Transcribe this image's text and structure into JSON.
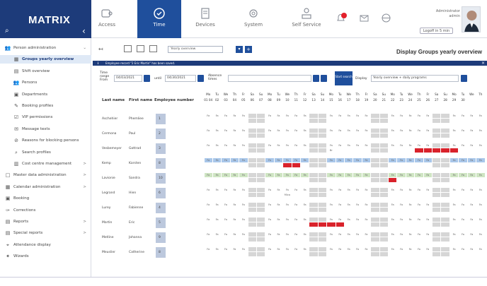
{
  "brand": {
    "name": "MATRIX",
    "search_icon": "search-icon",
    "collapse_icon": "chevron-left-icon"
  },
  "nav": [
    {
      "label": "Access",
      "icon": "door-access-icon",
      "active": false
    },
    {
      "label": "Time",
      "icon": "clock-icon",
      "active": true
    },
    {
      "label": "Devices",
      "icon": "terminal-device-icon",
      "active": false
    },
    {
      "label": "System",
      "icon": "gear-icon",
      "active": false
    },
    {
      "label": "Self Service",
      "icon": "person-desk-icon",
      "active": false
    }
  ],
  "header_icons": {
    "notification": "bell-icon",
    "mail": "mail-icon",
    "globe": "globe-icon"
  },
  "user": {
    "role": "Administrator",
    "name": "admin",
    "logoff": "Logoff in 5 min"
  },
  "sidebar": {
    "items": [
      {
        "label": "Person administration",
        "icon": "users-icon",
        "arrow": "⌄",
        "level": 0,
        "selected": false
      },
      {
        "label": "Groups yearly overview",
        "icon": "calendar-grid-icon",
        "arrow": "",
        "level": 1,
        "selected": true
      },
      {
        "label": "Shift overview",
        "icon": "chart-icon",
        "arrow": "",
        "level": 1,
        "selected": false
      },
      {
        "label": "Persons",
        "icon": "users-icon",
        "arrow": "",
        "level": 1,
        "selected": false
      },
      {
        "label": "Departments",
        "icon": "building-icon",
        "arrow": "",
        "level": 1,
        "selected": false
      },
      {
        "label": "Booking profiles",
        "icon": "pencil-icon",
        "arrow": "",
        "level": 1,
        "selected": false
      },
      {
        "label": "VIP permissions",
        "icon": "badge-icon",
        "arrow": "",
        "level": 1,
        "selected": false
      },
      {
        "label": "Message texts",
        "icon": "message-icon",
        "arrow": "",
        "level": 1,
        "selected": false
      },
      {
        "label": "Reasons for blocking persons",
        "icon": "block-person-icon",
        "arrow": "",
        "level": 1,
        "selected": false
      },
      {
        "label": "Search profiles",
        "icon": "search-icon",
        "arrow": "",
        "level": 1,
        "selected": false
      },
      {
        "label": "Cost centre management",
        "icon": "cost-centre-icon",
        "arrow": ">",
        "level": 1,
        "selected": false
      },
      {
        "label": "Master data administration",
        "icon": "document-icon",
        "arrow": ">",
        "level": 0,
        "selected": false
      },
      {
        "label": "Calendar administration",
        "icon": "calendar-icon",
        "arrow": ">",
        "level": 0,
        "selected": false
      },
      {
        "label": "Booking",
        "icon": "booking-icon",
        "arrow": "",
        "level": 0,
        "selected": false
      },
      {
        "label": "Corrections",
        "icon": "wrench-icon",
        "arrow": "",
        "level": 0,
        "selected": false
      },
      {
        "label": "Reports",
        "icon": "report-icon",
        "arrow": ">",
        "level": 0,
        "selected": false
      },
      {
        "label": "Special reports",
        "icon": "special-report-icon",
        "arrow": ">",
        "level": 0,
        "selected": false
      },
      {
        "label": "Attendance display",
        "icon": "location-pin-icon",
        "arrow": "",
        "level": 0,
        "selected": false
      },
      {
        "label": "Wizards",
        "icon": "wizard-icon",
        "arrow": "",
        "level": 0,
        "selected": false
      }
    ]
  },
  "toolbar": {
    "select": "Yearly overview",
    "icons": [
      "pin-icon",
      "print-icon",
      "export-icon",
      "print-preview-icon",
      "dropdown-toggle-icon",
      "add-icon"
    ]
  },
  "page": {
    "title": "Display Groups yearly overview"
  },
  "info": {
    "text": "Employee record \"2 Eric Martin\" has been saved.",
    "close": "×"
  },
  "filters": {
    "time_range_label": "Time range From",
    "from": "04/03/2021",
    "until_label": "until",
    "until": "04/30/2021",
    "absence_label": "Absence times",
    "absence_value": "",
    "start_search": "Start search",
    "display_label": "Display",
    "display_value": "Yearly overview + daily programs"
  },
  "table": {
    "headers": {
      "last": "Last name",
      "first": "First name",
      "number": "Employee number"
    },
    "day_names": [
      "Mo",
      "Tu",
      "We",
      "Th",
      "Fr",
      "Sa",
      "Su",
      "Mo",
      "Tu",
      "We",
      "Th",
      "Fr",
      "Sa",
      "Su",
      "Mo",
      "Tu",
      "We",
      "Th",
      "Fr",
      "Sa",
      "Su",
      "Mo",
      "Tu",
      "We",
      "Th",
      "Fr",
      "Sa",
      "Su",
      "Mo",
      "Tu",
      "We",
      "Th"
    ],
    "day_nums": [
      "01 04",
      "02",
      "03",
      "04",
      "05",
      "06",
      "07",
      "08",
      "09",
      "10",
      "11",
      "12",
      "13",
      "14",
      "15",
      "16",
      "17",
      "18",
      "19",
      "20",
      "21",
      "22",
      "23",
      "24",
      "25",
      "26",
      "27",
      "28",
      "29",
      "30",
      "",
      ""
    ],
    "rows": [
      {
        "last": "Aschehier",
        "first": "Phemliee",
        "number": "1"
      },
      {
        "last": "Cermona",
        "first": "Paul",
        "number": "2"
      },
      {
        "last": "Vesbemeyer",
        "first": "Gottrad",
        "number": "3"
      },
      {
        "last": "Kemp",
        "first": "Karsten",
        "number": "8"
      },
      {
        "last": "Lavionie",
        "first": "Sandra",
        "number": "10"
      },
      {
        "last": "Legrand",
        "first": "Hien",
        "number": "6"
      },
      {
        "last": "Lurey",
        "first": "Fabienne",
        "number": "4"
      },
      {
        "last": "Martin",
        "first": "Eric",
        "number": "5"
      },
      {
        "last": "Metline",
        "first": "Johanna",
        "number": "9"
      },
      {
        "last": "Meuslier",
        "first": "Catherine",
        "number": "8"
      }
    ],
    "cell_codes": [
      "Fa",
      "Fa",
      "Fa",
      "Fa",
      "Fa",
      "—",
      "—",
      "Fa",
      "Fa",
      "Fa",
      "Fa",
      "Fa",
      "—",
      "—",
      "Fa",
      "Fa",
      "Fa",
      "Fa",
      "Fa",
      "—",
      "—",
      "Fa",
      "Fa",
      "Fa",
      "Fa",
      "Fa",
      "—",
      "—",
      "Fa",
      "Fa",
      "Fa",
      "Fa"
    ],
    "special_marks": [
      "Br",
      "Mica",
      "Ho"
    ]
  },
  "colors": {
    "navy": "#1d3b7a",
    "blue": "#1f4f9c",
    "selected_bg": "#dfe9f6",
    "number_cell": "#bcc8dd",
    "weekend": "#d6d6d6",
    "red": "#d9222b",
    "green": "#cfe5c3",
    "blue_row": "#a9c7ea"
  }
}
